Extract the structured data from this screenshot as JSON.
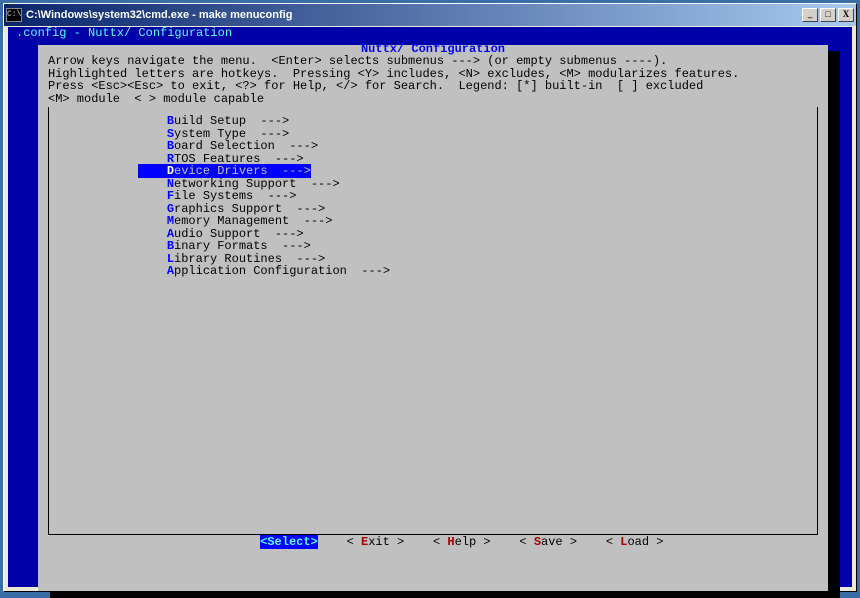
{
  "titlebar": {
    "icon_glyph": "C:\\",
    "text": "C:\\Windows\\system32\\cmd.exe - make  menuconfig",
    "minimize": "_",
    "maximize": "□",
    "close": "X"
  },
  "status_line": ".config - Nuttx/ Configuration",
  "box_title": "Nuttx/ Configuration",
  "help_lines": [
    "Arrow keys navigate the menu.  <Enter> selects submenus ---> (or empty submenus ----).",
    "Highlighted letters are hotkeys.  Pressing <Y> includes, <N> excludes, <M> modularizes features.",
    "Press <Esc><Esc> to exit, <?> for Help, </> for Search.  Legend: [*] built-in  [ ] excluded",
    "<M> module  < > module capable"
  ],
  "menu_items": [
    {
      "hotkey": "B",
      "label": "uild Setup  --->",
      "selected": false
    },
    {
      "hotkey": "S",
      "label": "ystem Type  --->",
      "selected": false
    },
    {
      "hotkey": "B",
      "label": "oard Selection  --->",
      "selected": false
    },
    {
      "hotkey": "R",
      "label": "TOS Features  --->",
      "selected": false
    },
    {
      "hotkey": "D",
      "label": "evice Drivers  --->",
      "selected": true
    },
    {
      "hotkey": "N",
      "label": "etworking Support  --->",
      "selected": false
    },
    {
      "hotkey": "F",
      "label": "ile Systems  --->",
      "selected": false
    },
    {
      "hotkey": "G",
      "label": "raphics Support  --->",
      "selected": false
    },
    {
      "hotkey": "M",
      "label": "emory Management  --->",
      "selected": false
    },
    {
      "hotkey": "A",
      "label": "udio Support  --->",
      "selected": false
    },
    {
      "hotkey": "B",
      "label": "inary Formats  --->",
      "selected": false
    },
    {
      "hotkey": "L",
      "label": "ibrary Routines  --->",
      "selected": false
    },
    {
      "hotkey": "A",
      "label": "pplication Configuration  --->",
      "selected": false
    }
  ],
  "buttons": {
    "select": "Select",
    "exit": {
      "hotkey": "E",
      "rest": "xit"
    },
    "help": {
      "hotkey": "H",
      "rest": "elp"
    },
    "save": {
      "hotkey": "S",
      "rest": "ave"
    },
    "load": {
      "hotkey": "L",
      "rest": "oad"
    }
  }
}
